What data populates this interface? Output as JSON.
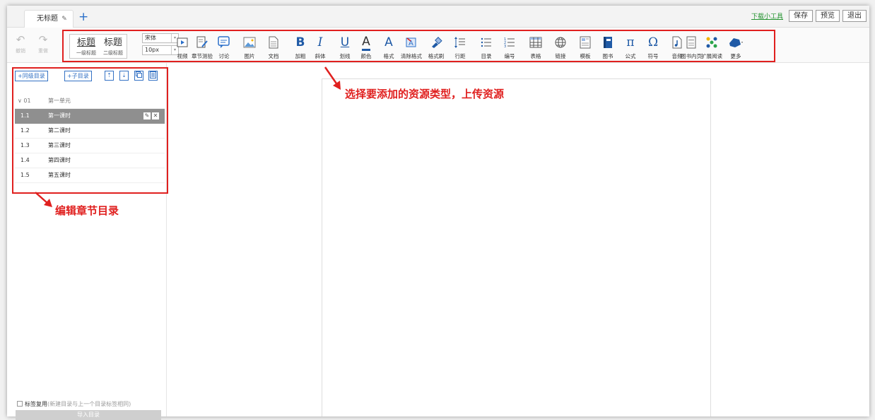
{
  "tabs": {
    "doc_title": "无标题",
    "edit_glyph": "✎",
    "add_glyph": "+"
  },
  "topbar": {
    "download_link": "下载小工具",
    "save": "保存",
    "preview": "预览",
    "exit": "退出"
  },
  "history": {
    "undo": "撤销",
    "redo": "重做",
    "undo_glyph": "↶",
    "redo_glyph": "↷"
  },
  "headings": {
    "h1_big": "标题",
    "h1_small": "一级标题",
    "h2_big": "标题",
    "h2_small": "二级标题"
  },
  "font": {
    "family_value": "宋体",
    "size_value": "10px",
    "dropdown_glyph": "▾"
  },
  "tools": [
    {
      "label": "视频",
      "icon": "video-icon"
    },
    {
      "label": "章节测验",
      "icon": "quiz-icon"
    },
    {
      "label": "讨论",
      "icon": "discussion-icon"
    },
    {
      "label": "图片",
      "icon": "image-icon"
    },
    {
      "label": "文档",
      "icon": "document-icon"
    },
    {
      "label": "加粗",
      "icon": "bold-icon",
      "glyph": "B"
    },
    {
      "label": "斜体",
      "icon": "italic-icon",
      "glyph": "I"
    },
    {
      "label": "划线",
      "icon": "underline-icon",
      "glyph": "U"
    },
    {
      "label": "颜色",
      "icon": "font-color-icon",
      "glyph": "A"
    },
    {
      "label": "格式",
      "icon": "font-size-icon",
      "glyph": "A"
    },
    {
      "label": "清除格式",
      "icon": "clear-format-icon"
    },
    {
      "label": "格式刷",
      "icon": "format-painter-icon"
    },
    {
      "label": "行距",
      "icon": "line-spacing-icon"
    },
    {
      "label": "目录",
      "icon": "bullet-list-icon"
    },
    {
      "label": "编号",
      "icon": "numbered-list-icon"
    },
    {
      "label": "表格",
      "icon": "table-icon"
    },
    {
      "label": "链接",
      "icon": "link-icon"
    },
    {
      "label": "模板",
      "icon": "template-icon"
    },
    {
      "label": "图书",
      "icon": "book-icon"
    },
    {
      "label": "公式",
      "icon": "formula-icon",
      "glyph": "π"
    },
    {
      "label": "符号",
      "icon": "symbol-icon",
      "glyph": "Ω"
    },
    {
      "label": "音频",
      "icon": "audio-icon"
    },
    {
      "label": "图书内页",
      "icon": "book-page-icon"
    },
    {
      "label": "扩展阅读",
      "icon": "extended-reading-icon"
    },
    {
      "label": "更多",
      "icon": "more-icon"
    }
  ],
  "sidebar": {
    "add_sibling": "+同级目录",
    "add_child": "+子目录",
    "move_up_glyph": "⇡",
    "move_down_glyph": "⇣",
    "chapter": {
      "num": "01",
      "title": "第一单元",
      "collapse_glyph": "∨"
    },
    "lessons": [
      {
        "num": "1.1",
        "title": "第一课时"
      },
      {
        "num": "1.2",
        "title": "第二课时"
      },
      {
        "num": "1.3",
        "title": "第三课时"
      },
      {
        "num": "1.4",
        "title": "第四课时"
      },
      {
        "num": "1.5",
        "title": "第五课时"
      }
    ],
    "row_edit_glyph": "✎",
    "row_delete_glyph": "✕",
    "reuse_label": "标签复用",
    "reuse_hint": "(新建目录与上一个目录标签相同)",
    "import_button": "导入目录"
  },
  "annotations": {
    "toolbar_note": "选择要添加的资源类型，上传资源",
    "sidebar_note": "编辑章节目录",
    "color": "#e0201f"
  }
}
